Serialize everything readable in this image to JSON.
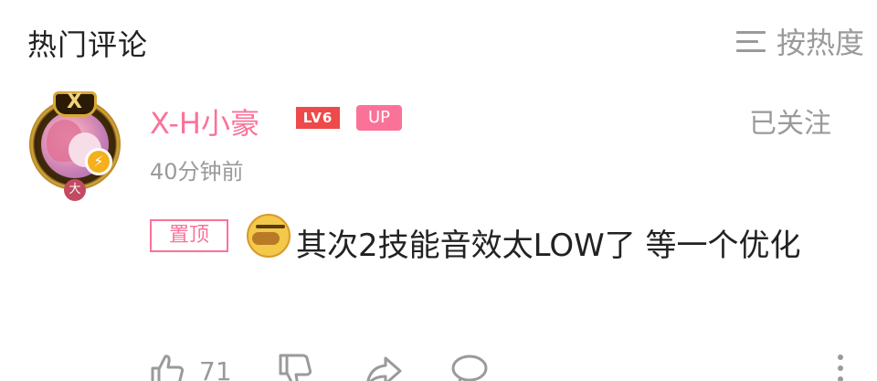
{
  "header": {
    "title": "热门评论",
    "sort_label": "按热度",
    "sort_icon": "menu-lines-icon"
  },
  "comment": {
    "username": "X-H小豪",
    "level": "LV6",
    "up_badge": "UP",
    "follow_status": "已关注",
    "timestamp": "40分钟前",
    "pinned_label": "置顶",
    "emoji": "facepalm-emoji-icon",
    "text": "其次2技能音效太LOW了 等一个优化",
    "avatar_badge_icon": "lightning-bolt-icon",
    "avatar_rank": "大",
    "actions": {
      "like_count": "71",
      "like_icon": "thumbs-up-icon",
      "dislike_icon": "thumbs-down-icon",
      "share_icon": "share-icon",
      "reply_icon": "comment-bubble-icon",
      "more_icon": "more-vertical-icon"
    }
  },
  "colors": {
    "accent_pink": "#fb7299",
    "level_red": "#ee4a4a",
    "muted_gray": "#9a9a9a"
  }
}
